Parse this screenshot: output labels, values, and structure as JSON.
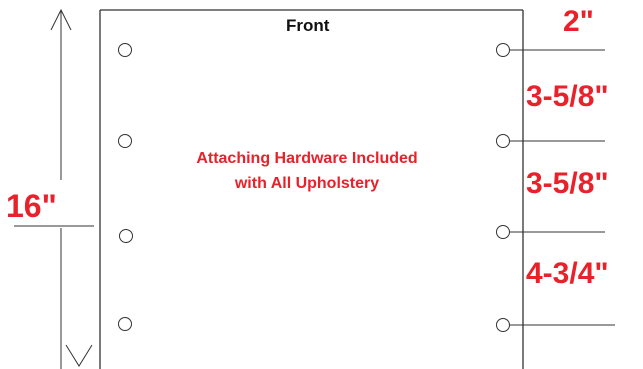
{
  "title": "Front",
  "note": "Attaching Hardware Included with All Upholstery",
  "dimensions": {
    "total_height": "16\"",
    "top_offset": "2\"",
    "spacing_1": "3-5/8\"",
    "spacing_2": "3-5/8\"",
    "spacing_3": "4-3/4\""
  },
  "colors": {
    "accent": "#e8212a",
    "line": "#333333",
    "text": "#111111"
  }
}
